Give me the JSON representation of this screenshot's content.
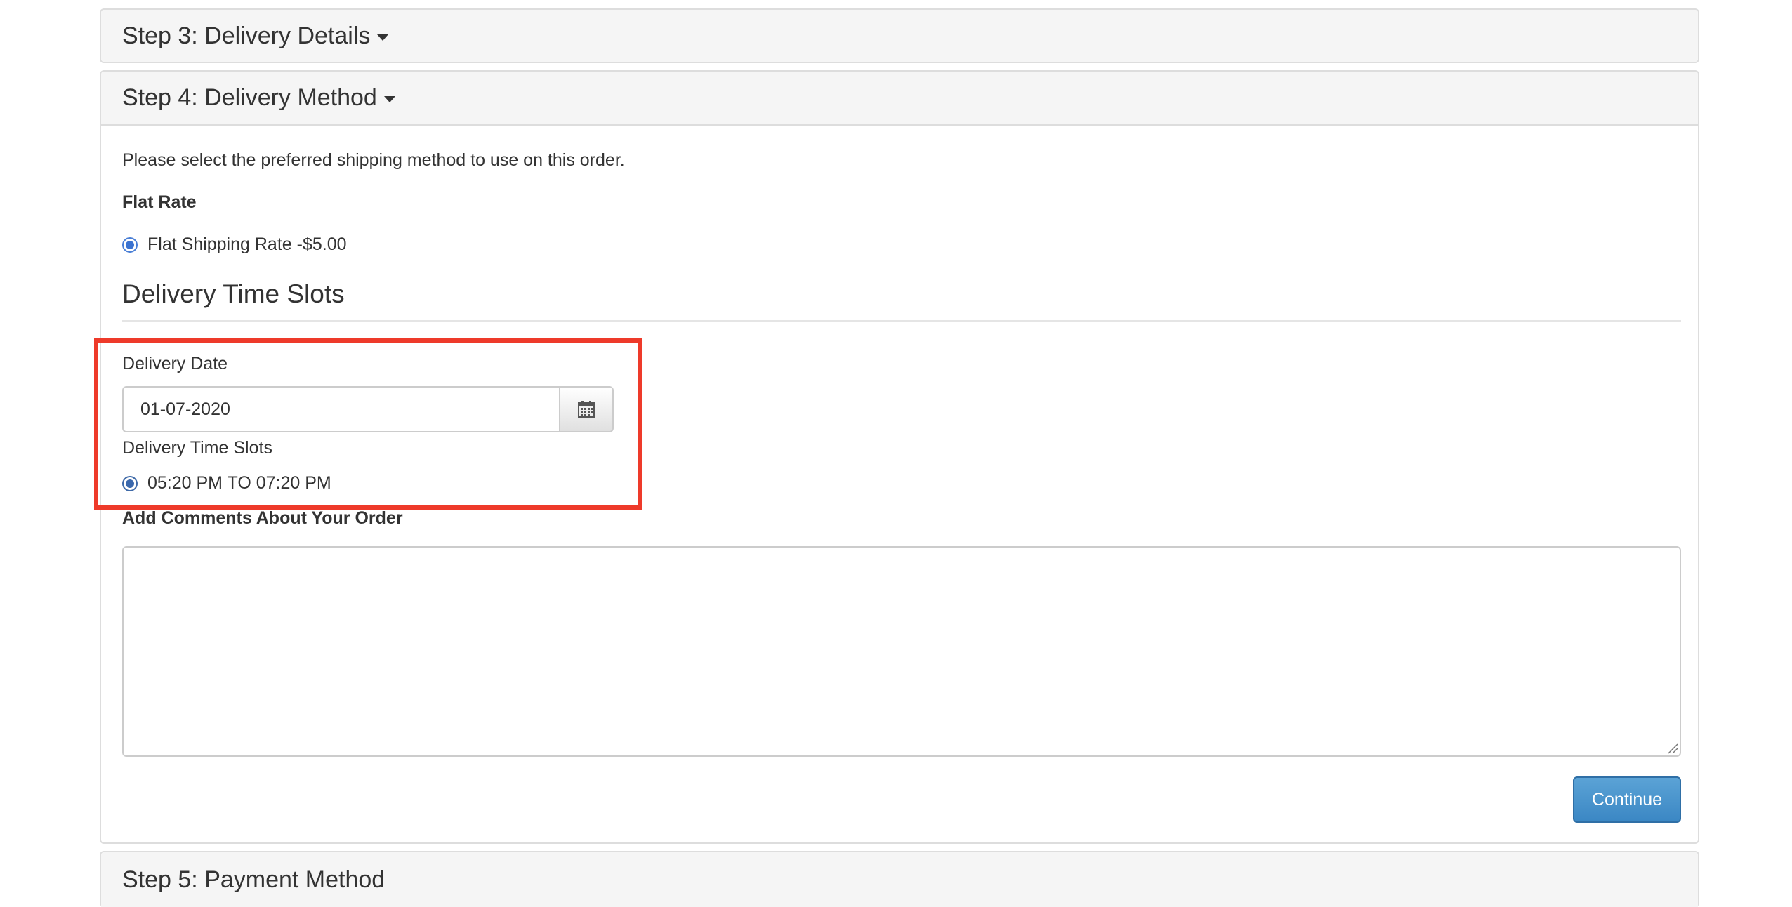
{
  "steps": {
    "step3": {
      "title": "Step 3: Delivery Details"
    },
    "step4": {
      "title": "Step 4: Delivery Method"
    },
    "step5": {
      "title": "Step 5: Payment Method"
    }
  },
  "delivery_method": {
    "intro": "Please select the preferred shipping method to use on this order.",
    "flat_rate_title": "Flat Rate",
    "flat_rate_option": "Flat Shipping Rate -$5.00",
    "flat_rate_selected": true
  },
  "time_slots": {
    "legend": "Delivery Time Slots",
    "date_label": "Delivery Date",
    "date_value": "01-07-2020",
    "slots_label": "Delivery Time Slots",
    "slot_option": "05:20 PM TO 07:20 PM",
    "slot_selected": true
  },
  "comments": {
    "label": "Add Comments About Your Order",
    "value": ""
  },
  "buttons": {
    "continue": "Continue"
  },
  "icons": {
    "calendar": "calendar-icon",
    "caret": "caret-down-icon"
  },
  "colors": {
    "highlight": "#ee3a2a",
    "primary_button": "#428bca",
    "radio": "#3b73d1"
  }
}
